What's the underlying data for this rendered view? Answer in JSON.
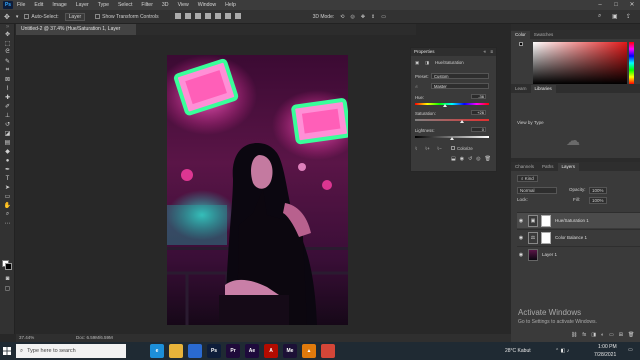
{
  "menu": {
    "logo": "Ps",
    "items": [
      "File",
      "Edit",
      "Image",
      "Layer",
      "Type",
      "Select",
      "Filter",
      "3D",
      "View",
      "Window",
      "Help"
    ]
  },
  "options": {
    "auto_select": "Auto-Select:",
    "layer_dropdown": "Layer",
    "show_transform": "Show Transform Controls"
  },
  "document": {
    "tab_title": "Untitled-2 @ 37.4% (Hue/Saturation 1, Layer Mask/8) *",
    "zoom": "37.44%",
    "doc_size": "Doc: 6.59M/6.59M"
  },
  "properties": {
    "title": "Properties",
    "adjustment": "Hue/Saturation",
    "preset_label": "Preset:",
    "preset_value": "Custom",
    "channel_value": "Master",
    "hue_label": "Hue:",
    "hue_value": "-36",
    "hue_fraction": 0.4,
    "saturation_label": "Saturation:",
    "saturation_value": "+26",
    "saturation_fraction": 0.63,
    "lightness_label": "Lightness:",
    "lightness_value": "0",
    "lightness_fraction": 0.5,
    "colorize_label": "Colorize"
  },
  "panels": {
    "color_tabs": [
      "Color",
      "Swatches"
    ],
    "library_tabs": [
      "Learn",
      "Libraries"
    ],
    "view_by": "View by Type",
    "layers_tabs": [
      "Channels",
      "Paths",
      "Layers"
    ],
    "kind_label": "Kind",
    "blend_mode": "Normal",
    "opacity_label": "Opacity:",
    "opacity_value": "100%",
    "lock_label": "Lock:",
    "fill_label": "Fill:",
    "fill_value": "100%",
    "layers": [
      {
        "name": "Hue/Saturation 1",
        "selected": true
      },
      {
        "name": "Color Balance 1",
        "selected": false
      },
      {
        "name": "Layer 1",
        "selected": false
      }
    ]
  },
  "watermark": {
    "title": "Activate Windows",
    "subtitle": "Go to Settings to activate Windows."
  },
  "taskbar": {
    "search_placeholder": "Type here to search",
    "weather": "28°C  Kabut",
    "time": "1:00 PM",
    "date": "7/28/2021",
    "apps": [
      {
        "icon": "task-view-icon",
        "label": "",
        "color": "#1f2a33"
      },
      {
        "icon": "edge-icon",
        "label": "e",
        "color": "#1d8fd8"
      },
      {
        "icon": "file-explorer-icon",
        "label": "",
        "color": "#e8b33a"
      },
      {
        "icon": "store-icon",
        "label": "",
        "color": "#2a6ad1"
      },
      {
        "icon": "photoshop-icon",
        "label": "Ps",
        "color": "#0e1d3a"
      },
      {
        "icon": "premiere-icon",
        "label": "Pr",
        "color": "#1f0a3a"
      },
      {
        "icon": "after-effects-icon",
        "label": "Ae",
        "color": "#1e0a3c"
      },
      {
        "icon": "acrobat-icon",
        "label": "A",
        "color": "#b30b00"
      },
      {
        "icon": "media-encoder-icon",
        "label": "Me",
        "color": "#1c1036"
      },
      {
        "icon": "vlc-icon",
        "label": "▲",
        "color": "#e07a0c"
      },
      {
        "icon": "chrome-icon",
        "label": "",
        "color": "#d44638"
      }
    ]
  },
  "colors": {
    "accent": "#31a8ff",
    "panel": "#3a3a3a",
    "canvas": "#282828"
  }
}
